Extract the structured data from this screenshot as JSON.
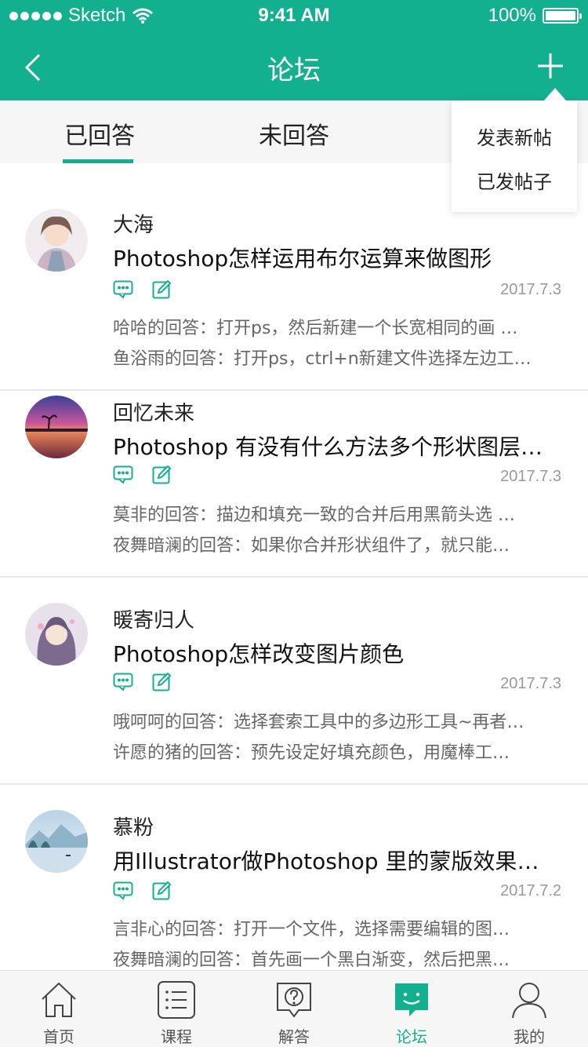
{
  "status": {
    "carrier": "Sketch",
    "time": "9:41 AM",
    "battery": "100%"
  },
  "nav": {
    "title": "论坛"
  },
  "tabs": [
    {
      "label": "已回答"
    },
    {
      "label": "未回答"
    }
  ],
  "dropdown": {
    "items": [
      {
        "label": "发表新帖"
      },
      {
        "label": "已发帖子"
      }
    ]
  },
  "posts": [
    {
      "author": "大海",
      "title": "Photoshop怎样运用布尔运算来做图形",
      "date": "2017.7.3",
      "replies": [
        "哈哈的回答：打开ps，然后新建一个长宽相同的画 …",
        "鱼浴雨的回答：打开ps，ctrl+n新建文件选择左边工…"
      ]
    },
    {
      "author": "回忆未来",
      "title": "Photoshop 有没有什么方法多个形状图层…",
      "date": "2017.7.3",
      "replies": [
        "莫非的回答：描边和填充一致的合并后用黑箭头选 …",
        "夜舞暗澜的回答：如果你合并形状组件了，就只能…"
      ]
    },
    {
      "author": "暖寄归人",
      "title": "Photoshop怎样改变图片颜色",
      "date": "2017.7.3",
      "replies": [
        "哦呵呵的回答：选择套索工具中的多边形工具~再者…",
        "许愿的猪的回答：预先设定好填充颜色，用魔棒工…"
      ]
    },
    {
      "author": "慕粉",
      "title": "用Illustrator做Photoshop 里的蒙版效果怎…",
      "date": "2017.7.2",
      "replies": [
        "言非心的回答：打开一个文件，选择需要编辑的图…",
        "夜舞暗澜的回答：首先画一个黑白渐变，然后把黑…"
      ]
    }
  ],
  "tabbar": [
    {
      "label": "首页"
    },
    {
      "label": "课程"
    },
    {
      "label": "解答"
    },
    {
      "label": "论坛"
    },
    {
      "label": "我的"
    }
  ],
  "colors": {
    "accent": "#13B08F",
    "text": "#222222",
    "muted": "#999999"
  },
  "icons": {
    "back": "chevron-left-icon",
    "add": "plus-icon",
    "comment": "comment-icon",
    "edit": "edit-icon"
  }
}
